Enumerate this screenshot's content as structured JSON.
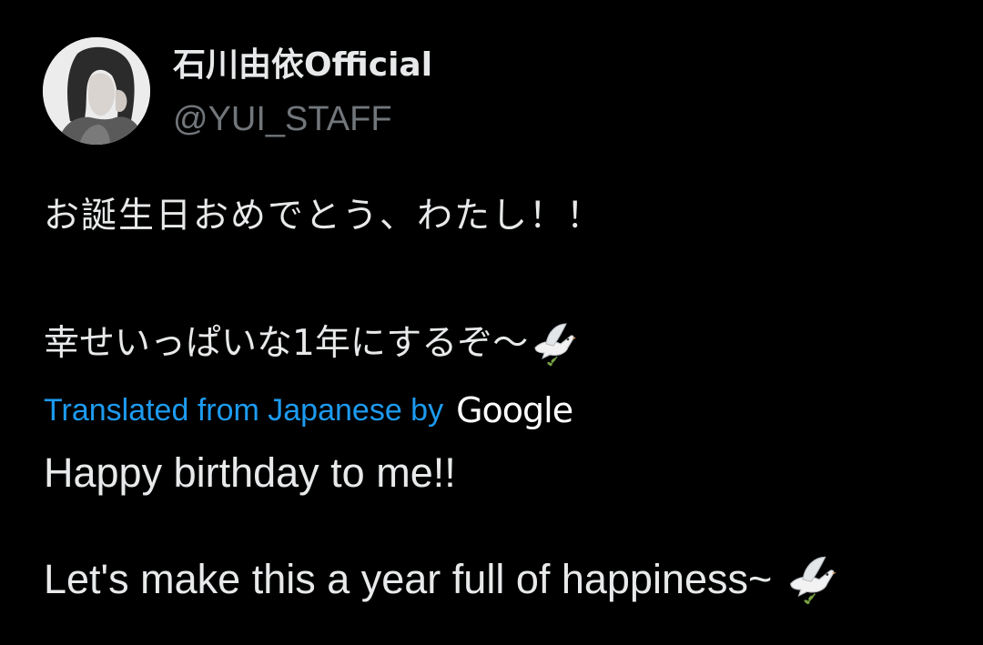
{
  "tweet": {
    "author": {
      "display_name": "石川由依Official",
      "handle": "@YUI_STAFF",
      "avatar_icon": "profile-photo"
    },
    "text_original": {
      "line1": "お誕生日おめでとう、わたし！！",
      "line2": "幸せいっぱいな1年にするぞ〜",
      "emoji": "dove-icon"
    },
    "translation": {
      "label": "Translated from Japanese by",
      "provider": "Google",
      "line1": "Happy birthday to me!!",
      "line2": "Let's make this a year full of happiness~"
    }
  },
  "colors": {
    "background": "#000000",
    "text": "#e7e9ea",
    "secondary_text": "#71767b",
    "link": "#1d9bf0"
  }
}
